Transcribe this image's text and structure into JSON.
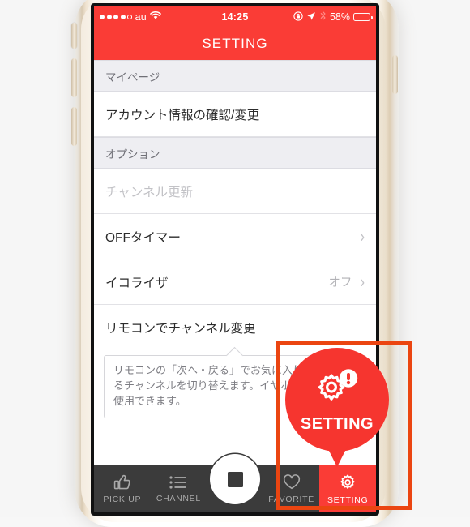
{
  "status_bar": {
    "signal_dots_filled": 4,
    "signal_dots_total": 5,
    "carrier": "au",
    "wifi_icon": "wifi-icon",
    "time": "14:25",
    "rotation_lock_icon": "rotation-lock-icon",
    "location_icon": "location-arrow-icon",
    "bluetooth_icon": "bluetooth-icon",
    "battery_percent": "58%",
    "battery_level": 58
  },
  "navbar": {
    "title": "SETTING"
  },
  "sections": [
    {
      "header": "マイページ",
      "rows": [
        {
          "label": "アカウント情報の確認/変更",
          "value": "",
          "chevron": false,
          "disabled": false
        }
      ]
    },
    {
      "header": "オプション",
      "rows": [
        {
          "label": "チャンネル更新",
          "value": "",
          "chevron": false,
          "disabled": true
        },
        {
          "label": "OFFタイマー",
          "value": "",
          "chevron": true,
          "disabled": false
        },
        {
          "label": "イコライザ",
          "value": "オフ",
          "chevron": true,
          "disabled": false
        },
        {
          "label": "リモコンでチャンネル変更",
          "value": "",
          "chevron": false,
          "disabled": false
        }
      ]
    }
  ],
  "tooltip": {
    "text": "リモコンの「次へ・戻る」でお気に入り登録しているチャンネルを切り替えます。イヤホン接続時のみ使用できます。"
  },
  "tabbar": {
    "items": [
      {
        "label": "PICK UP",
        "icon": "thumbs-up-icon",
        "active": false
      },
      {
        "label": "CHANNEL",
        "icon": "list-icon",
        "active": false
      },
      {
        "label": "FAVORITE",
        "icon": "heart-icon",
        "active": false
      },
      {
        "label": "SETTING",
        "icon": "gear-icon",
        "active": true
      }
    ],
    "center_button": {
      "icon": "stop-icon"
    }
  },
  "annotation": {
    "callout_label": "SETTING",
    "callout_icon": "gear-alert-icon",
    "callout_color": "#F6352F",
    "highlight_color": "#EB4511"
  },
  "theme": {
    "accent_red": "#FA3C36",
    "tabbar_bg": "#3B3B3B",
    "section_bg": "#EEEEF2"
  }
}
